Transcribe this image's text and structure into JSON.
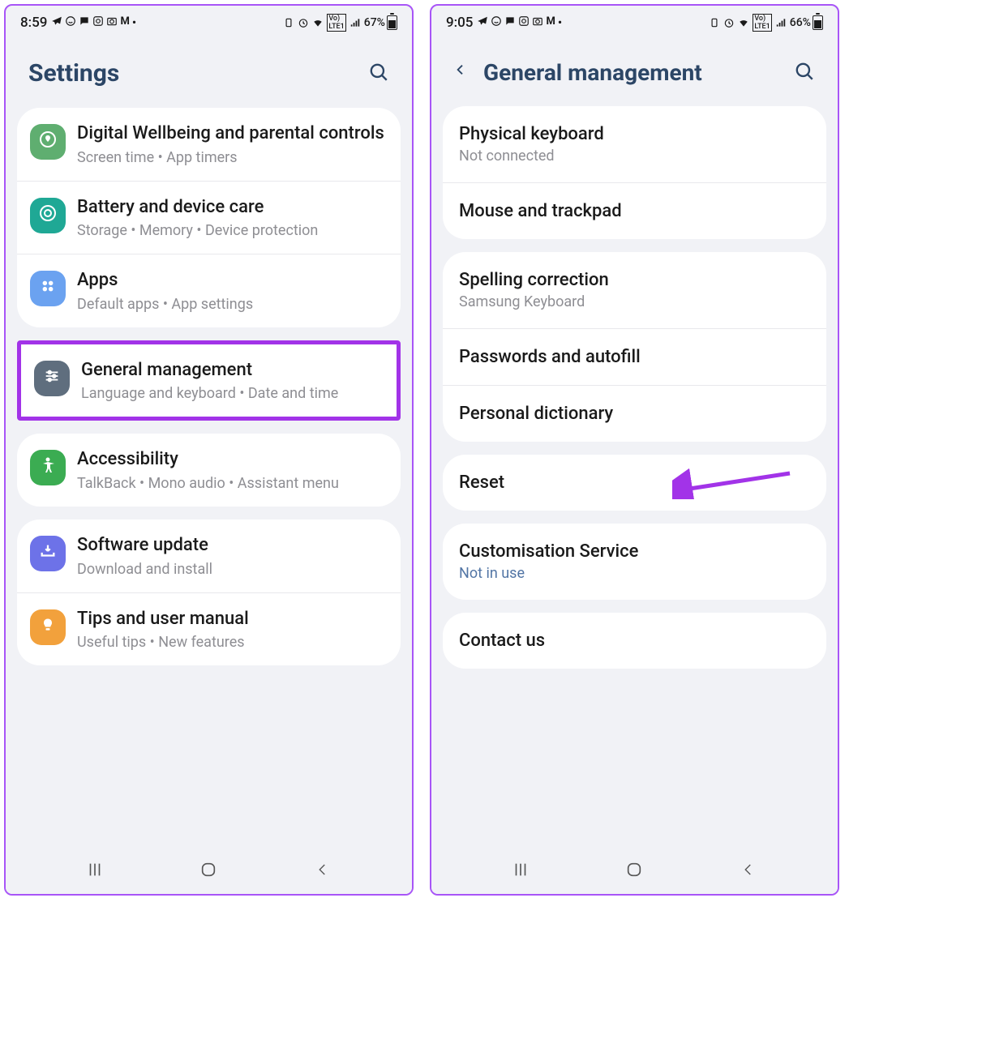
{
  "left": {
    "status": {
      "time": "8:59",
      "battery": "67%"
    },
    "header": {
      "title": "Settings"
    },
    "groups": [
      {
        "items": [
          {
            "id": "digital-wellbeing",
            "icon_bg": "#5fae70",
            "icon": "◎",
            "title": "Digital Wellbeing and parental controls",
            "subtitle": "Screen time  •  App timers",
            "divider": true
          },
          {
            "id": "battery-care",
            "icon_bg": "#1fa895",
            "icon": "◎",
            "title": "Battery and device care",
            "subtitle": "Storage  •  Memory  •  Device protection",
            "divider": true
          },
          {
            "id": "apps",
            "icon_bg": "#6ba2f0",
            "icon": "⠕",
            "title": "Apps",
            "subtitle": "Default apps  •  App settings",
            "divider": false
          }
        ]
      },
      {
        "highlight": true,
        "items": [
          {
            "id": "general-management",
            "icon_bg": "#5f6e7e",
            "icon": "☰",
            "title": "General management",
            "subtitle": "Language and keyboard  •  Date and time",
            "divider": false
          }
        ]
      },
      {
        "items": [
          {
            "id": "accessibility",
            "icon_bg": "#3bac52",
            "icon": "⛑",
            "title": "Accessibility",
            "subtitle": "TalkBack  •  Mono audio  •  Assistant menu",
            "divider": false
          }
        ]
      },
      {
        "items": [
          {
            "id": "software-update",
            "icon_bg": "#6d72e8",
            "icon": "↻",
            "title": "Software update",
            "subtitle": "Download and install",
            "divider": true
          },
          {
            "id": "tips-manual",
            "icon_bg": "#f2a13c",
            "icon": "💡",
            "title": "Tips and user manual",
            "subtitle": "Useful tips  •  New features",
            "divider": false
          }
        ]
      }
    ]
  },
  "right": {
    "status": {
      "time": "9:05",
      "battery": "66%"
    },
    "header": {
      "title": "General management"
    },
    "cards": [
      {
        "items": [
          {
            "id": "physical-keyboard",
            "title": "Physical keyboard",
            "subtitle": "Not connected",
            "divider": true
          },
          {
            "id": "mouse-trackpad",
            "title": "Mouse and trackpad",
            "divider": false
          }
        ]
      },
      {
        "items": [
          {
            "id": "spelling-correction",
            "title": "Spelling correction",
            "subtitle": "Samsung Keyboard",
            "divider": true
          },
          {
            "id": "passwords-autofill",
            "title": "Passwords and autofill",
            "divider": true
          },
          {
            "id": "personal-dictionary",
            "title": "Personal dictionary",
            "divider": false
          }
        ]
      },
      {
        "items": [
          {
            "id": "reset",
            "title": "Reset",
            "arrow": true,
            "divider": false
          }
        ]
      },
      {
        "items": [
          {
            "id": "customisation-service",
            "title": "Customisation Service",
            "subtitle": "Not in use",
            "subtitle_blue": true,
            "divider": false
          }
        ]
      },
      {
        "items": [
          {
            "id": "contact-us",
            "title": "Contact us",
            "divider": false
          }
        ]
      }
    ]
  }
}
